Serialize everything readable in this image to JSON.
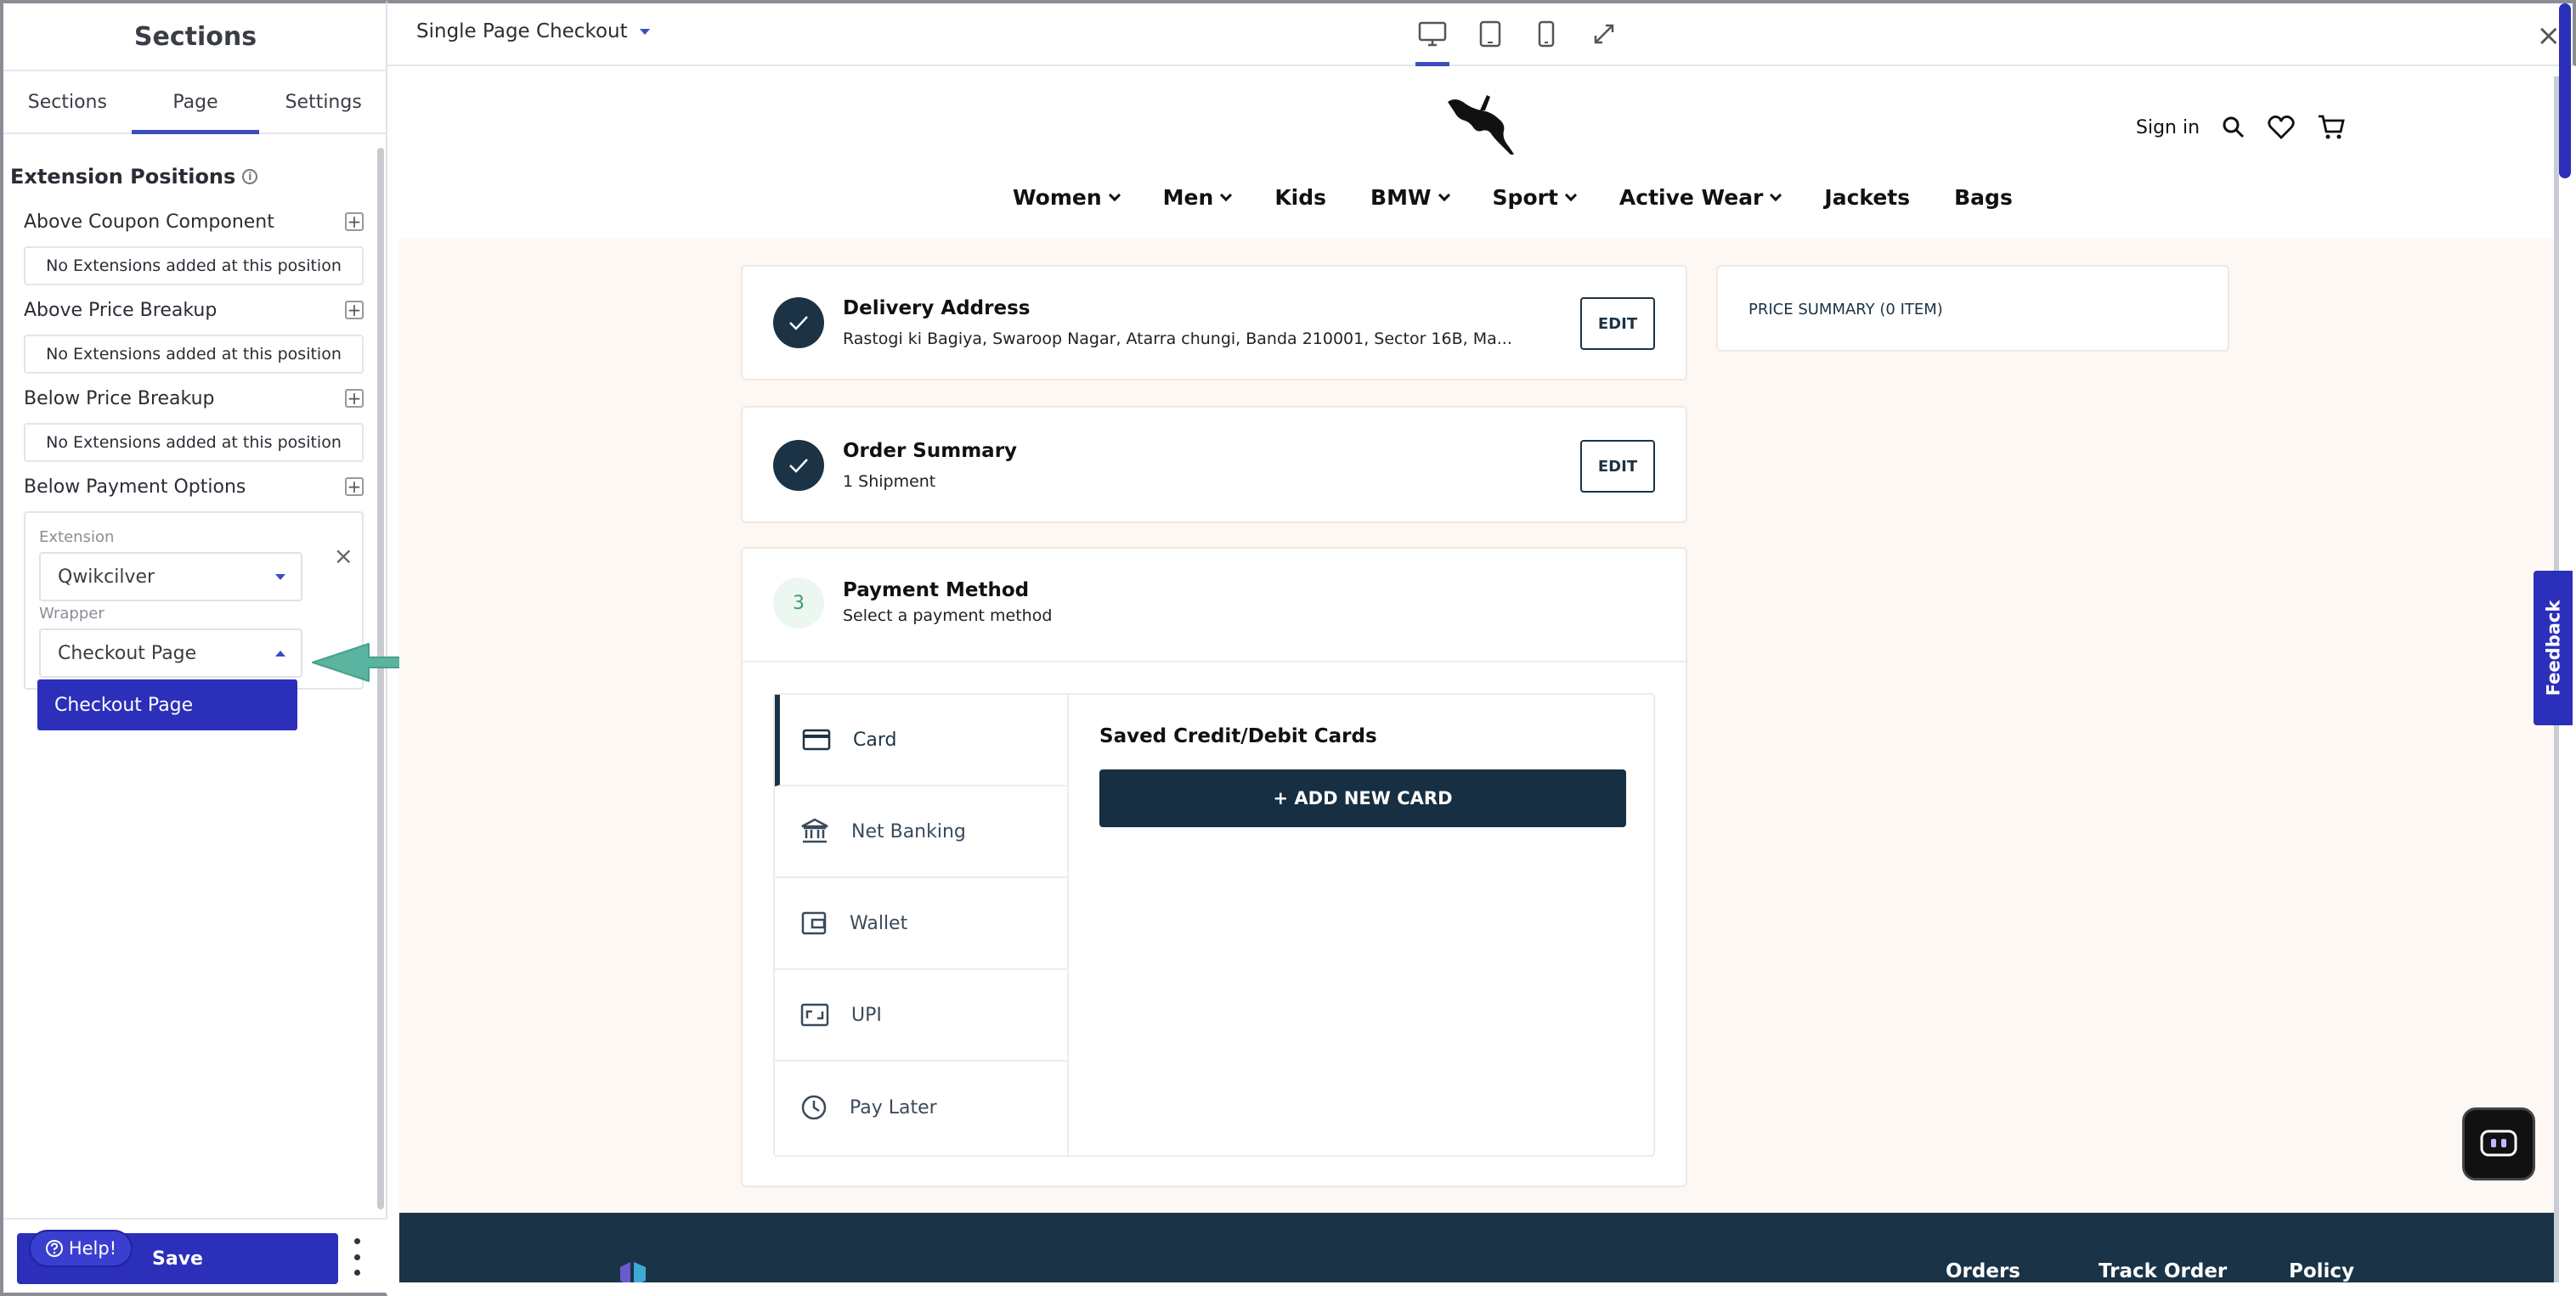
{
  "sidebar": {
    "title": "Sections",
    "tabs": [
      "Sections",
      "Page",
      "Settings"
    ],
    "active_tab": "Page",
    "extension_positions_title": "Extension Positions",
    "info_glyph": "i",
    "positions": [
      {
        "label": "Above Coupon Component",
        "empty_text": "No Extensions added at this position"
      },
      {
        "label": "Above Price Breakup",
        "empty_text": "No Extensions added at this position"
      },
      {
        "label": "Below Price Breakup",
        "empty_text": "No Extensions added at this position"
      },
      {
        "label": "Below Payment Options"
      }
    ],
    "plus_glyph": "+",
    "extension_label": "Extension",
    "extension_value": "Qwikcilver",
    "wrapper_label": "Wrapper",
    "wrapper_value": "Checkout Page",
    "wrapper_option": "Checkout Page",
    "close_glyph": "×",
    "save_label": "Save",
    "help_label": "Help!"
  },
  "topbar": {
    "page_name": "Single Page Checkout",
    "close_glyph": "×",
    "devices": [
      "desktop-icon",
      "tablet-icon",
      "mobile-icon",
      "expand-icon"
    ],
    "active_device": "desktop-icon"
  },
  "site": {
    "sign_in": "Sign in",
    "nav": [
      {
        "label": "Women",
        "dropdown": true
      },
      {
        "label": "Men",
        "dropdown": true
      },
      {
        "label": "Kids",
        "dropdown": false
      },
      {
        "label": "BMW",
        "dropdown": true
      },
      {
        "label": "Sport",
        "dropdown": true
      },
      {
        "label": "Active Wear",
        "dropdown": true
      },
      {
        "label": "Jackets",
        "dropdown": false
      },
      {
        "label": "Bags",
        "dropdown": false
      }
    ],
    "delivery": {
      "title": "Delivery Address",
      "sub": "Rastogi ki Bagiya, Swaroop Nagar, Atarra chungi, Banda 210001, Sector 16B, Ma...",
      "edit": "EDIT"
    },
    "order": {
      "title": "Order Summary",
      "sub": "1 Shipment",
      "edit": "EDIT"
    },
    "payment": {
      "step": "3",
      "title": "Payment Method",
      "sub": "Select a payment method",
      "methods": [
        "Card",
        "Net Banking",
        "Wallet",
        "UPI",
        "Pay Later"
      ],
      "active_method": "Card",
      "saved_title": "Saved Credit/Debit Cards",
      "add_card": "+ ADD NEW CARD"
    },
    "price_summary": "PRICE SUMMARY (0 ITEM)",
    "footer_links": [
      "Orders",
      "Track Order",
      "Policy"
    ],
    "feedback": "Feedback"
  },
  "colors": {
    "accent": "#2b2fb9",
    "navy": "#1b3345",
    "teal_arrow": "#5ab4a0",
    "preview_bg": "#fdf8f4"
  }
}
